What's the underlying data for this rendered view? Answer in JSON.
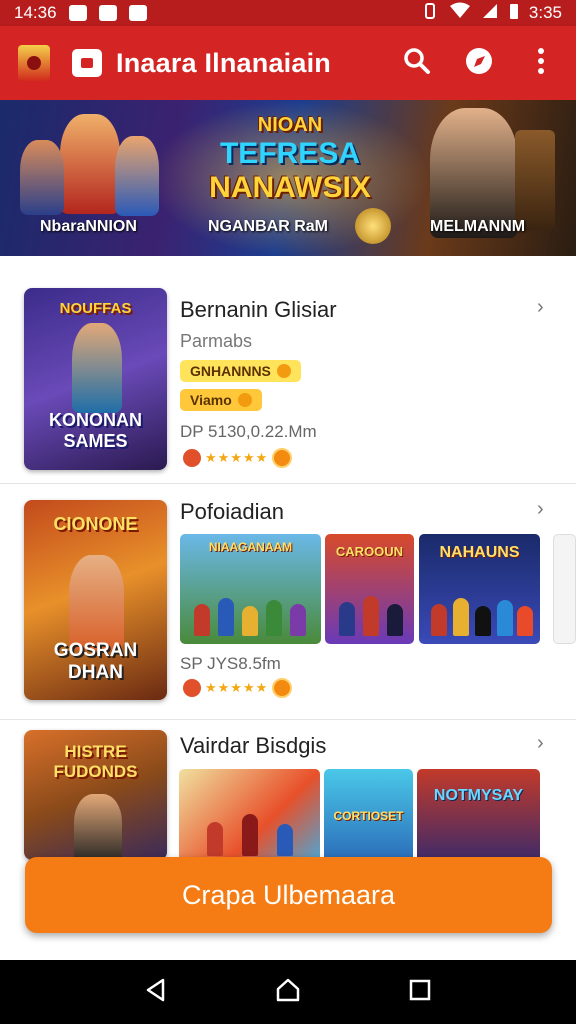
{
  "status_bar": {
    "time_left": "14:36",
    "time_right": "3:35"
  },
  "app_bar": {
    "title": "Inaara Ilnanaiain"
  },
  "hero": {
    "title_line1": "NIOAN",
    "title_line2": "TEFRESA",
    "title_line3": "NANAWSIX",
    "labels": [
      "NbaraNNION",
      "NGANBAR RaM",
      "MELMANNM"
    ]
  },
  "games": [
    {
      "title": "Bernanin Glisiar",
      "subtitle": "Parmabs",
      "tags": [
        "GNHANNNS",
        "Viamo"
      ],
      "meta": "DP 5130,0.22.Mm",
      "thumb_top": "NOUFFAS",
      "thumb_bottom": "KONONAN SAMES",
      "stars": "★★★★★"
    },
    {
      "title": "Pofoiadian",
      "meta": "SP JYS8.5fm",
      "thumb_top": "CIONONE",
      "thumb_bottom": "GOSRAN DHAN",
      "stars": "★★★★★",
      "shots": [
        "NIAAGANAAM",
        "CAROOUN",
        "NAHAUNS"
      ]
    },
    {
      "title": "Vairdar Bisdgis",
      "thumb_top": "HISTRE FUDONDS",
      "shots": [
        "",
        "CORTIOSET",
        "NOTMYSAY"
      ]
    }
  ],
  "cta": {
    "label": "Crapa Ulbemaara"
  },
  "colors": {
    "primary": "#d42424",
    "accent": "#f57c14",
    "star": "#f3a712"
  },
  "icons": [
    "search-icon",
    "compass-icon",
    "more-vert-icon",
    "back-icon",
    "home-icon",
    "recents-icon"
  ]
}
